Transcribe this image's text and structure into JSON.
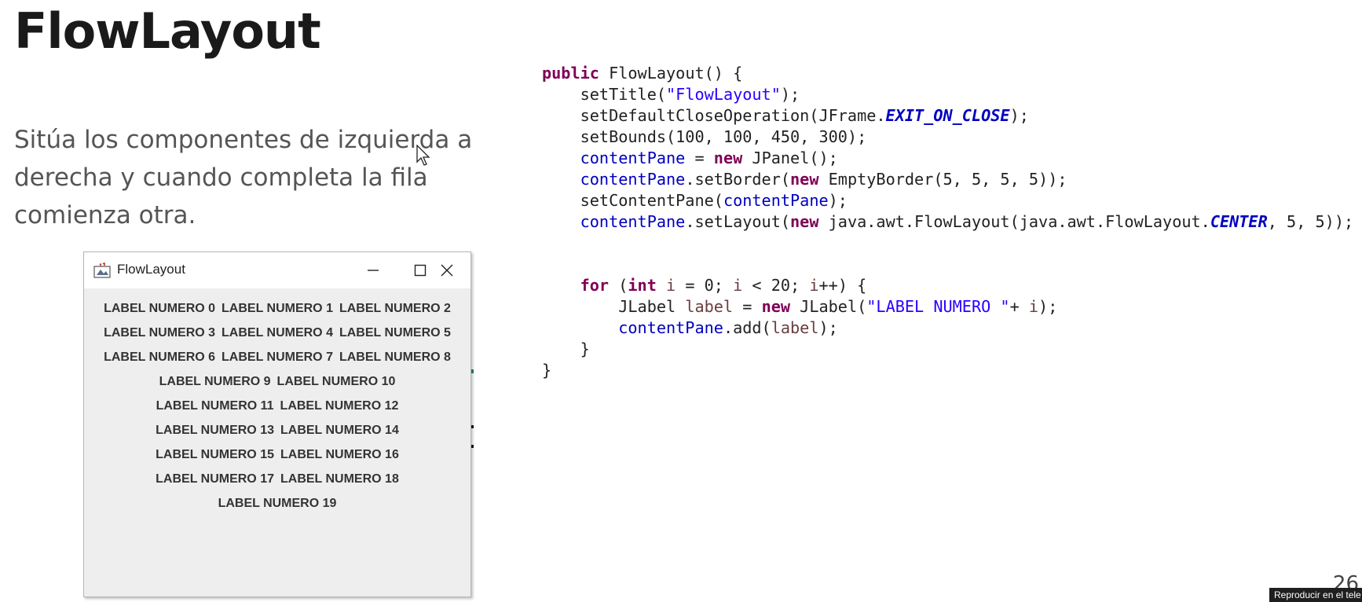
{
  "slide": {
    "title": "FlowLayout",
    "description_lines": [
      "Sitúa los componentes de izquierda a",
      "derecha y cuando completa la fila",
      "comienza otra."
    ],
    "page_number": "26"
  },
  "window": {
    "title": "FlowLayout",
    "rows": [
      [
        "LABEL NUMERO 0",
        "LABEL NUMERO 1",
        "LABEL NUMERO 2"
      ],
      [
        "LABEL NUMERO 3",
        "LABEL NUMERO 4",
        "LABEL NUMERO 5"
      ],
      [
        "LABEL NUMERO 6",
        "LABEL NUMERO 7",
        "LABEL NUMERO 8"
      ],
      [
        "LABEL NUMERO 9",
        "LABEL NUMERO 10"
      ],
      [
        "LABEL NUMERO 11",
        "LABEL NUMERO 12"
      ],
      [
        "LABEL NUMERO 13",
        "LABEL NUMERO 14"
      ],
      [
        "LABEL NUMERO 15",
        "LABEL NUMERO 16"
      ],
      [
        "LABEL NUMERO 17",
        "LABEL NUMERO 18"
      ],
      [
        "LABEL NUMERO 19"
      ]
    ],
    "icons": [
      "java-icon",
      "minimize-icon",
      "maximize-icon",
      "close-icon"
    ]
  },
  "code": [
    [
      {
        "t": "public",
        "c": "kw"
      },
      {
        "t": " FlowLayout() {"
      }
    ],
    [
      {
        "t": "    setTitle("
      },
      {
        "t": "\"FlowLayout\"",
        "c": "str"
      },
      {
        "t": ");"
      }
    ],
    [
      {
        "t": "    setDefaultCloseOperation(JFrame."
      },
      {
        "t": "EXIT_ON_CLOSE",
        "c": "sfld"
      },
      {
        "t": ");"
      }
    ],
    [
      {
        "t": "    setBounds(100, 100, 450, 300);"
      }
    ],
    [
      {
        "t": "    "
      },
      {
        "t": "contentPane",
        "c": "fld"
      },
      {
        "t": " = "
      },
      {
        "t": "new",
        "c": "kw"
      },
      {
        "t": " JPanel();"
      }
    ],
    [
      {
        "t": "    "
      },
      {
        "t": "contentPane",
        "c": "fld"
      },
      {
        "t": ".setBorder("
      },
      {
        "t": "new",
        "c": "kw"
      },
      {
        "t": " EmptyBorder(5, 5, 5, 5));"
      }
    ],
    [
      {
        "t": "    setContentPane("
      },
      {
        "t": "contentPane",
        "c": "fld"
      },
      {
        "t": ");"
      }
    ],
    [
      {
        "t": "    "
      },
      {
        "t": "contentPane",
        "c": "fld"
      },
      {
        "t": ".setLayout("
      },
      {
        "t": "new",
        "c": "kw"
      },
      {
        "t": " java.awt.FlowLayout(java.awt.FlowLayout."
      },
      {
        "t": "CENTER",
        "c": "sfld"
      },
      {
        "t": ", 5, 5));"
      }
    ],
    [],
    [],
    [
      {
        "t": "    "
      },
      {
        "t": "for",
        "c": "kw"
      },
      {
        "t": " ("
      },
      {
        "t": "int",
        "c": "kw"
      },
      {
        "t": " "
      },
      {
        "t": "i",
        "c": "var"
      },
      {
        "t": " = 0; "
      },
      {
        "t": "i",
        "c": "var"
      },
      {
        "t": " < 20; "
      },
      {
        "t": "i",
        "c": "var"
      },
      {
        "t": "++) {"
      }
    ],
    [
      {
        "t": "        JLabel "
      },
      {
        "t": "label",
        "c": "var"
      },
      {
        "t": " = "
      },
      {
        "t": "new",
        "c": "kw"
      },
      {
        "t": " JLabel("
      },
      {
        "t": "\"LABEL NUMERO \"",
        "c": "str"
      },
      {
        "t": "+ "
      },
      {
        "t": "i",
        "c": "var"
      },
      {
        "t": ");"
      }
    ],
    [
      {
        "t": "        "
      },
      {
        "t": "contentPane",
        "c": "fld"
      },
      {
        "t": ".add("
      },
      {
        "t": "label",
        "c": "var"
      },
      {
        "t": ");"
      }
    ],
    [
      {
        "t": "    }"
      }
    ],
    [
      {
        "t": "}"
      }
    ]
  ],
  "tooltip": "Reproducir en el tele",
  "colors": {
    "keyword": "#7f0055",
    "string": "#2a00ff",
    "field": "#0000c0",
    "variable": "#6a3e3e",
    "window_bg": "#eeeeee"
  }
}
